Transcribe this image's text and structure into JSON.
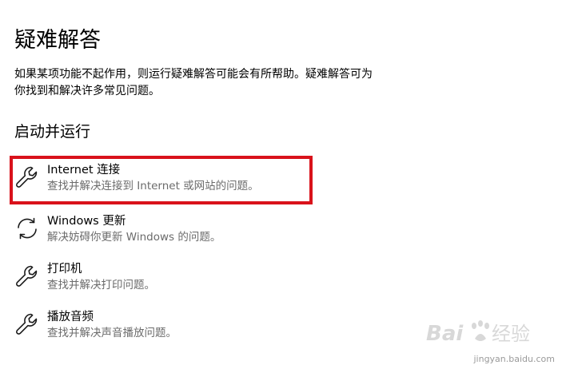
{
  "page": {
    "title": "疑难解答",
    "description": "如果某项功能不起作用，则运行疑难解答可能会有所帮助。疑难解答可为你找到和解决许多常见问题。",
    "section_title": "启动并运行"
  },
  "items": [
    {
      "icon": "wrench-icon",
      "name": "Internet 连接",
      "sub": "查找并解决连接到 Internet 或网站的问题。",
      "highlighted": true
    },
    {
      "icon": "sync-icon",
      "name": "Windows 更新",
      "sub": "解决妨碍你更新 Windows 的问题。",
      "highlighted": false
    },
    {
      "icon": "wrench-icon",
      "name": "打印机",
      "sub": "查找并解决打印问题。",
      "highlighted": false
    },
    {
      "icon": "wrench-icon",
      "name": "播放音频",
      "sub": "查找并解决声音播放问题。",
      "highlighted": false
    }
  ],
  "colors": {
    "highlight_border": "#d9121b",
    "secondary_text": "#6b6b6b"
  },
  "watermark": {
    "url": "jingyan.baidu.com"
  }
}
